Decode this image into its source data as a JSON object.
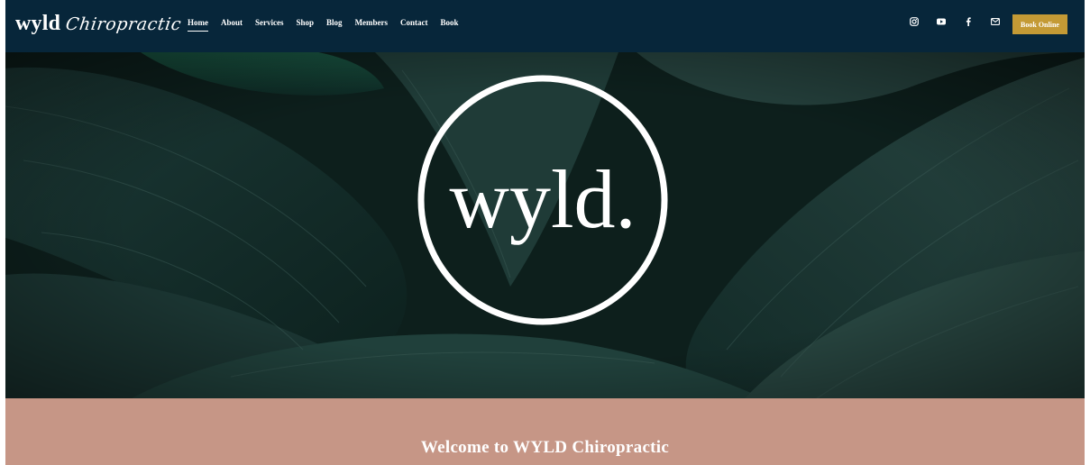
{
  "header": {
    "logo_word": "wyld",
    "logo_script": "Chiropractic",
    "menu": [
      {
        "label": "Home",
        "active": true
      },
      {
        "label": "About",
        "active": false
      },
      {
        "label": "Services",
        "active": false
      },
      {
        "label": "Shop",
        "active": false
      },
      {
        "label": "Blog",
        "active": false
      },
      {
        "label": "Members",
        "active": false
      },
      {
        "label": "Contact",
        "active": false
      },
      {
        "label": "Book",
        "active": false
      }
    ],
    "social_icons": [
      "instagram-icon",
      "youtube-icon",
      "facebook-icon",
      "email-icon"
    ],
    "book_button_label": "Book Online"
  },
  "hero": {
    "logo_text": "wyld."
  },
  "welcome": {
    "title": "Welcome to WYLD Chiropractic"
  },
  "colors": {
    "nav_bg": "#07263a",
    "accent_gold": "#c49a35",
    "welcome_bg": "#c69686",
    "hero_leaf_dark": "#0f2622",
    "white": "#ffffff"
  }
}
